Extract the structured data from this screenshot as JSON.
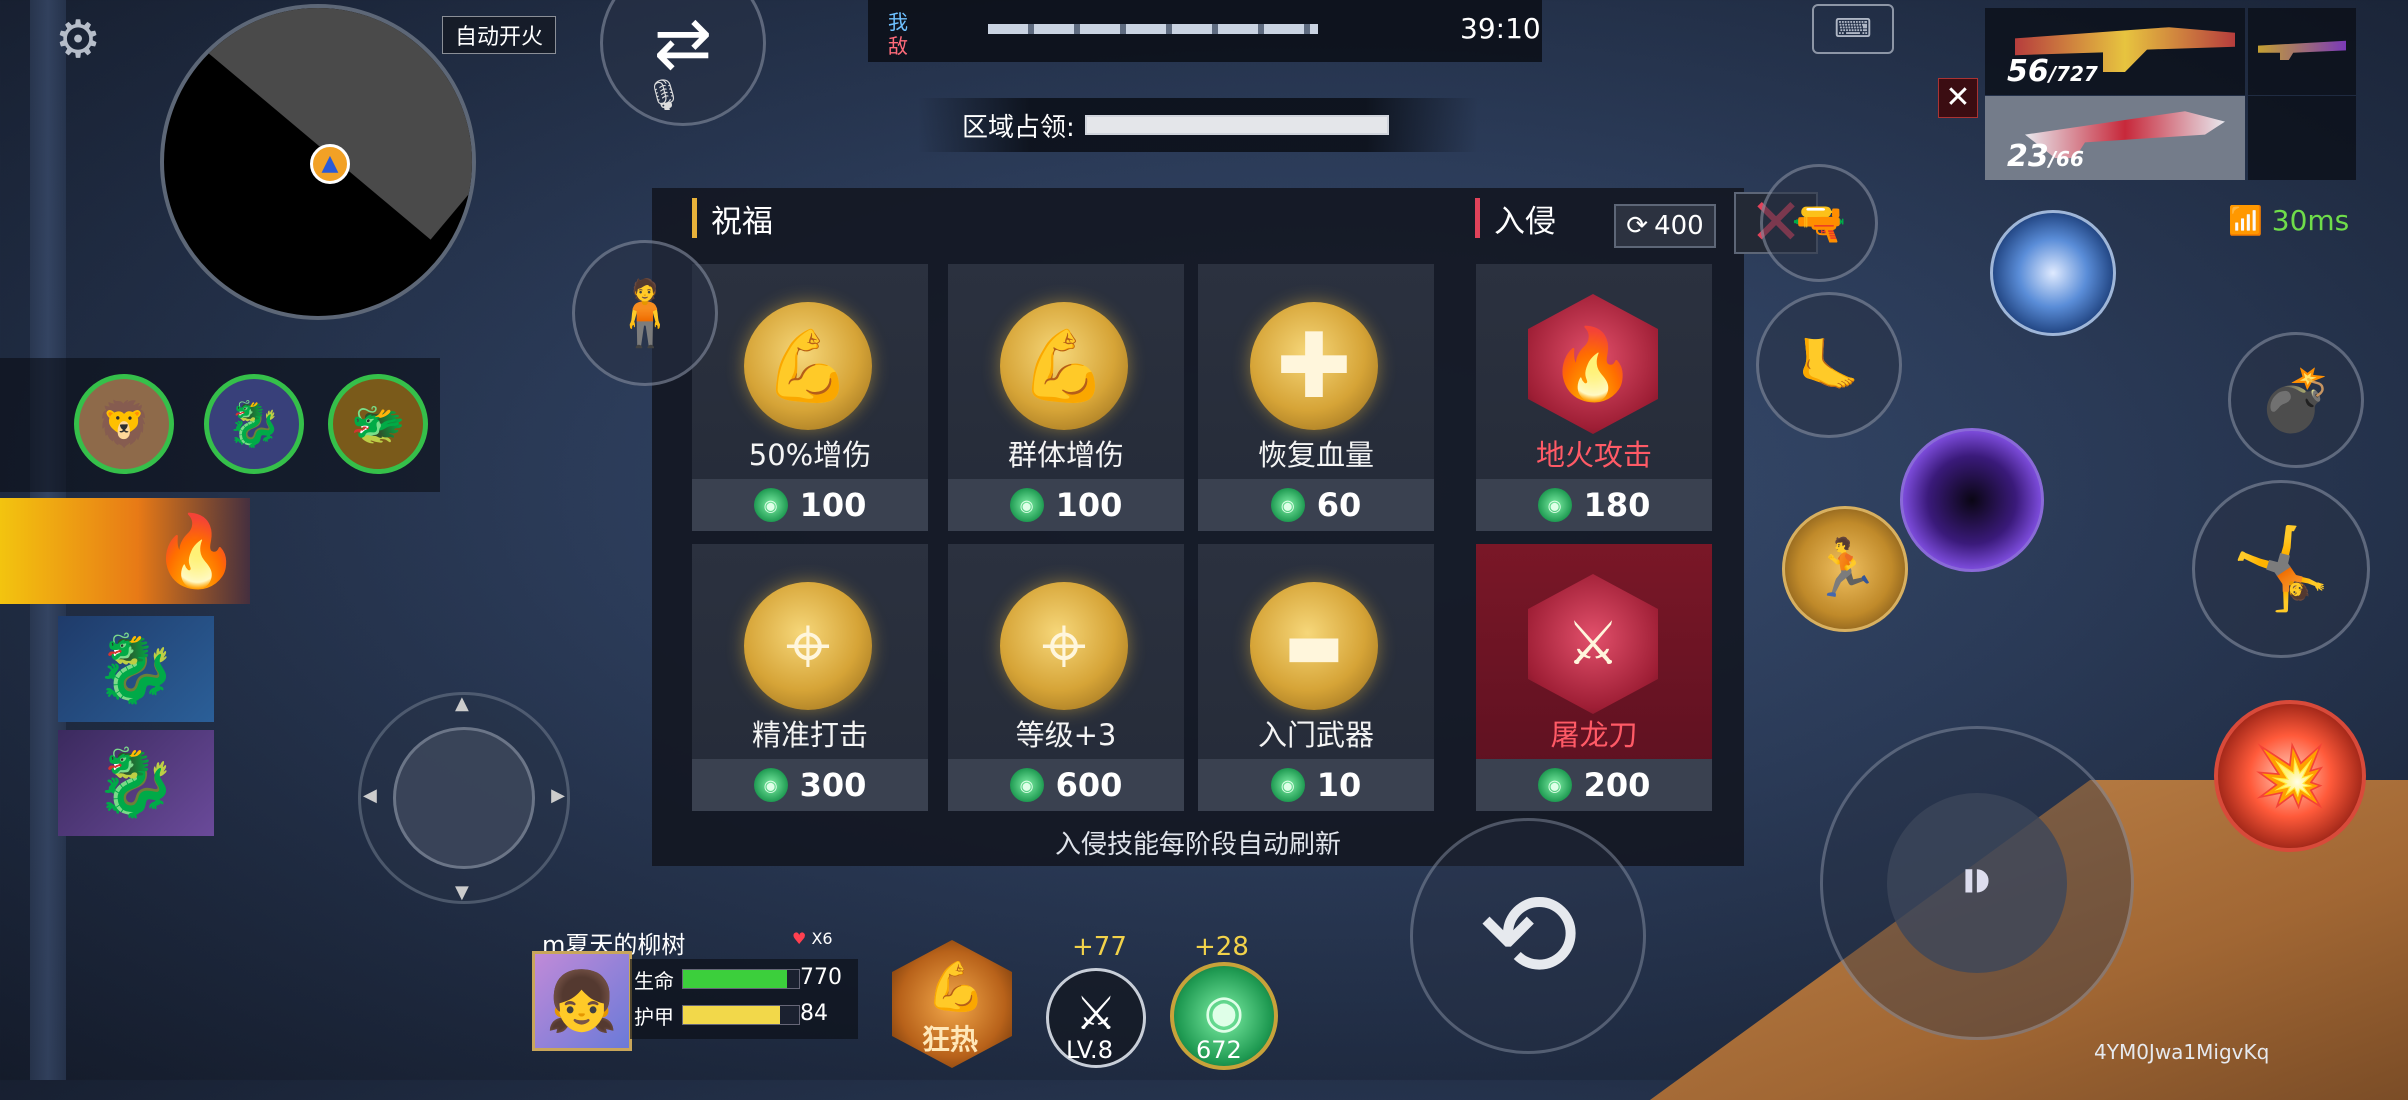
{
  "hud": {
    "auto_fire_label": "自动开火",
    "match_timer": "39:10",
    "team_self": "我",
    "team_enemy": "敌",
    "region_capture_label": "区域占领:",
    "ping": "30ms",
    "watermark": "4YM0Jwa1MigvKq"
  },
  "weapons": {
    "primary_ammo": "56",
    "primary_reserve": "/727",
    "secondary_ammo": "23",
    "secondary_reserve": "/66"
  },
  "shop": {
    "blessing_title": "祝福",
    "invasion_title": "入侵",
    "refresh_cost": "400",
    "footer_note": "入侵技能每阶段自动刷新",
    "blessings": [
      {
        "name": "50%增伤",
        "price": "100",
        "icon": "muscle-icon"
      },
      {
        "name": "群体增伤",
        "price": "100",
        "icon": "muscle-group-icon"
      },
      {
        "name": "恢复血量",
        "price": "60",
        "icon": "health-cross-icon"
      },
      {
        "name": "精准打击",
        "price": "300",
        "icon": "crosshair-icon"
      },
      {
        "name": "等级+3",
        "price": "600",
        "icon": "crosshair-level-icon"
      },
      {
        "name": "入门武器",
        "price": "10",
        "icon": "rifle-icon"
      }
    ],
    "invasions": [
      {
        "name": "地火攻击",
        "price": "180",
        "icon": "fire-icon"
      },
      {
        "name": "屠龙刀",
        "price": "200",
        "icon": "dragon-blade-icon"
      }
    ]
  },
  "player": {
    "name": "m夏天的柳树",
    "lives": "X6",
    "hp_label": "生命",
    "hp_value": "770",
    "hp_fraction": 0.9,
    "armor_label": "护甲",
    "armor_value": "84",
    "armor_fraction": 0.84
  },
  "rewards": {
    "frenzy_label": "狂热",
    "weapon_bonus": "+77",
    "weapon_level": "LV.8",
    "coin_bonus": "+28",
    "coin_total": "672"
  },
  "colors": {
    "blessing_accent": "#e8b23a",
    "invasion_accent": "#e0425a",
    "hp_bar": "#3ccf3c",
    "armor_bar": "#f2d84a",
    "ping_green": "#6fdd4a"
  }
}
